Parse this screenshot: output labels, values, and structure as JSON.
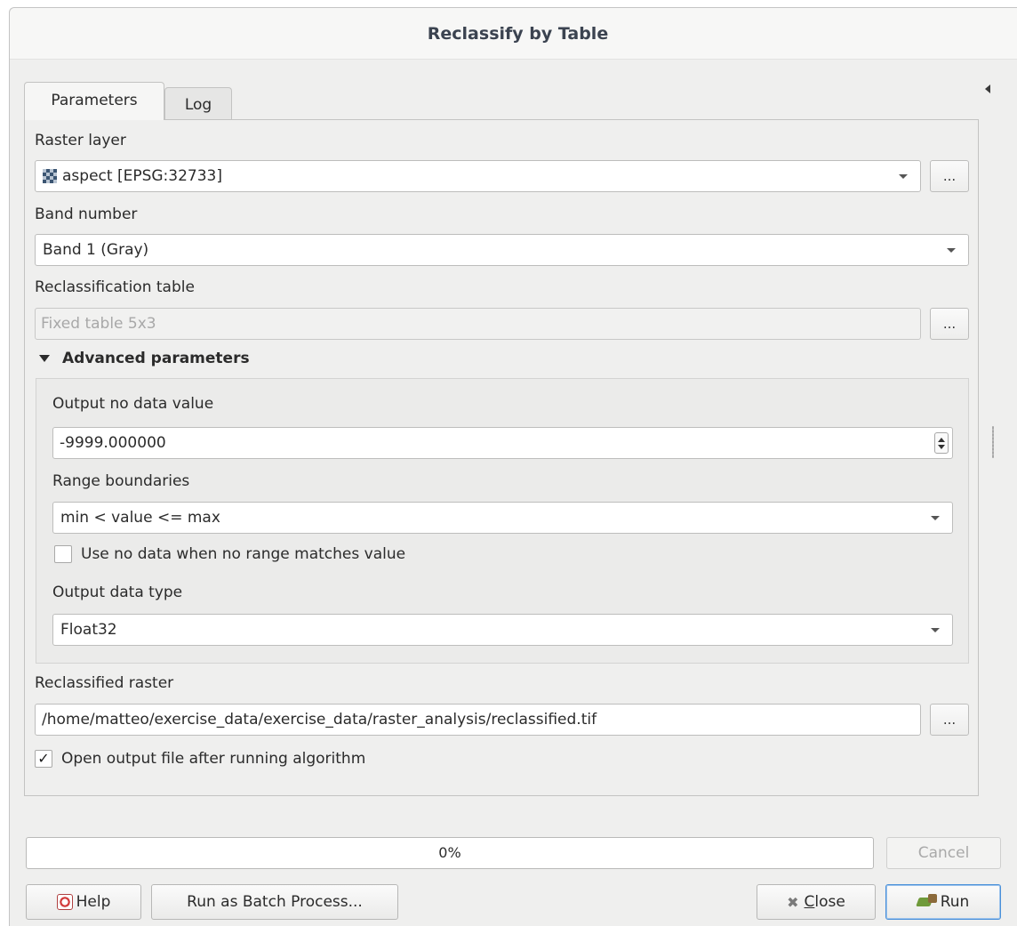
{
  "window": {
    "title": "Reclassify by Table"
  },
  "tabs": [
    {
      "label": "Parameters",
      "active": true
    },
    {
      "label": "Log",
      "active": false
    }
  ],
  "params": {
    "raster_layer_label": "Raster layer",
    "raster_layer_value": "aspect [EPSG:32733]",
    "band_number_label": "Band number",
    "band_number_value": "Band 1 (Gray)",
    "reclass_table_label": "Reclassification table",
    "reclass_table_value": "Fixed table 5x3",
    "browse_label": "...",
    "advanced_label": "Advanced parameters",
    "output_nodata_label": "Output no data value",
    "output_nodata_value": "-9999.000000",
    "range_boundaries_label": "Range boundaries",
    "range_boundaries_value": "min < value <= max",
    "use_nodata_label": "Use no data when no range matches value",
    "use_nodata_checked": false,
    "output_type_label": "Output data type",
    "output_type_value": "Float32",
    "reclassified_raster_label": "Reclassified raster",
    "reclassified_raster_value": "/home/matteo/exercise_data/exercise_data/raster_analysis/reclassified.tif",
    "open_output_label": "Open output file after running algorithm",
    "open_output_checked": true,
    "check_mark": "✓"
  },
  "footer": {
    "progress_text": "0%",
    "progress": 0,
    "cancel_label": "Cancel",
    "help_label": "Help",
    "batch_label": "Run as Batch Process...",
    "close_label_mnemonic": "C",
    "close_label_rest": "lose",
    "run_label": "Run"
  },
  "icons": {
    "raster": "raster-layer-icon",
    "help": "help-icon",
    "close": "close-icon",
    "run": "run-icon"
  }
}
